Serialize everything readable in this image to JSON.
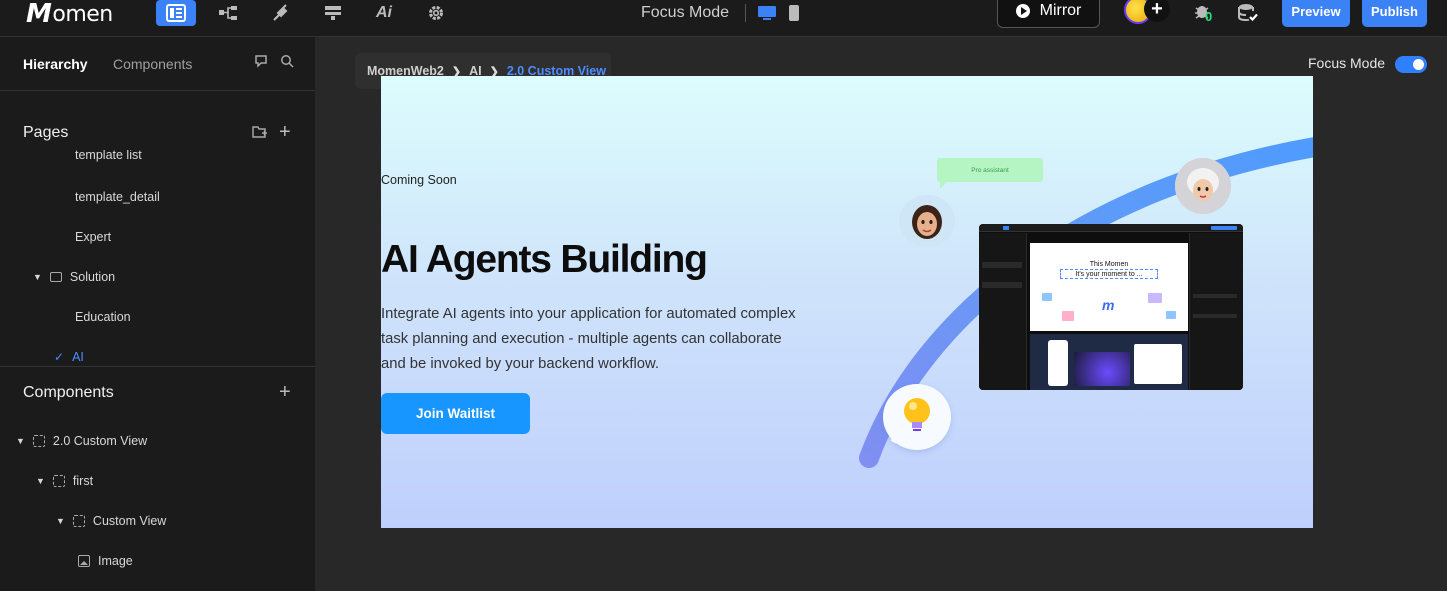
{
  "topbar": {
    "logo_text": "omen",
    "logo_initial": "M",
    "focus_mode_label": "Focus Mode",
    "mirror_label": "Mirror",
    "version_badge": "0",
    "preview_label": "Preview",
    "publish_label": "Publish",
    "accent_color": "#3b82f6"
  },
  "sidebar": {
    "tabs": [
      {
        "label": "Hierarchy"
      },
      {
        "label": "Components"
      }
    ],
    "pages_title": "Pages",
    "pages": [
      {
        "label": "template list"
      },
      {
        "label": "template_detail"
      },
      {
        "label": "Expert"
      },
      {
        "label": "Solution"
      },
      {
        "label": "Education"
      },
      {
        "label": "AI"
      }
    ],
    "components_title": "Components",
    "components": [
      {
        "label": "2.0 Custom View"
      },
      {
        "label": "first"
      },
      {
        "label": "Custom View"
      },
      {
        "label": "Image"
      }
    ]
  },
  "breadcrumb": {
    "items": [
      "MomenWeb2",
      "AI",
      "2.0 Custom View"
    ]
  },
  "focus_toggle": {
    "label": "Focus Mode",
    "checked": true
  },
  "canvas": {
    "coming_soon": "Coming Soon",
    "headline": "AI Agents Building",
    "description": "Integrate AI agents into your application for automated complex task planning and execution - multiple agents can collaborate and be invoked by your backend workflow.",
    "cta_label": "Join Waitlist",
    "bubble_text": "Pro assistant",
    "mock_title": "This Momen",
    "mock_subtitle": "It's your moment to ..."
  }
}
